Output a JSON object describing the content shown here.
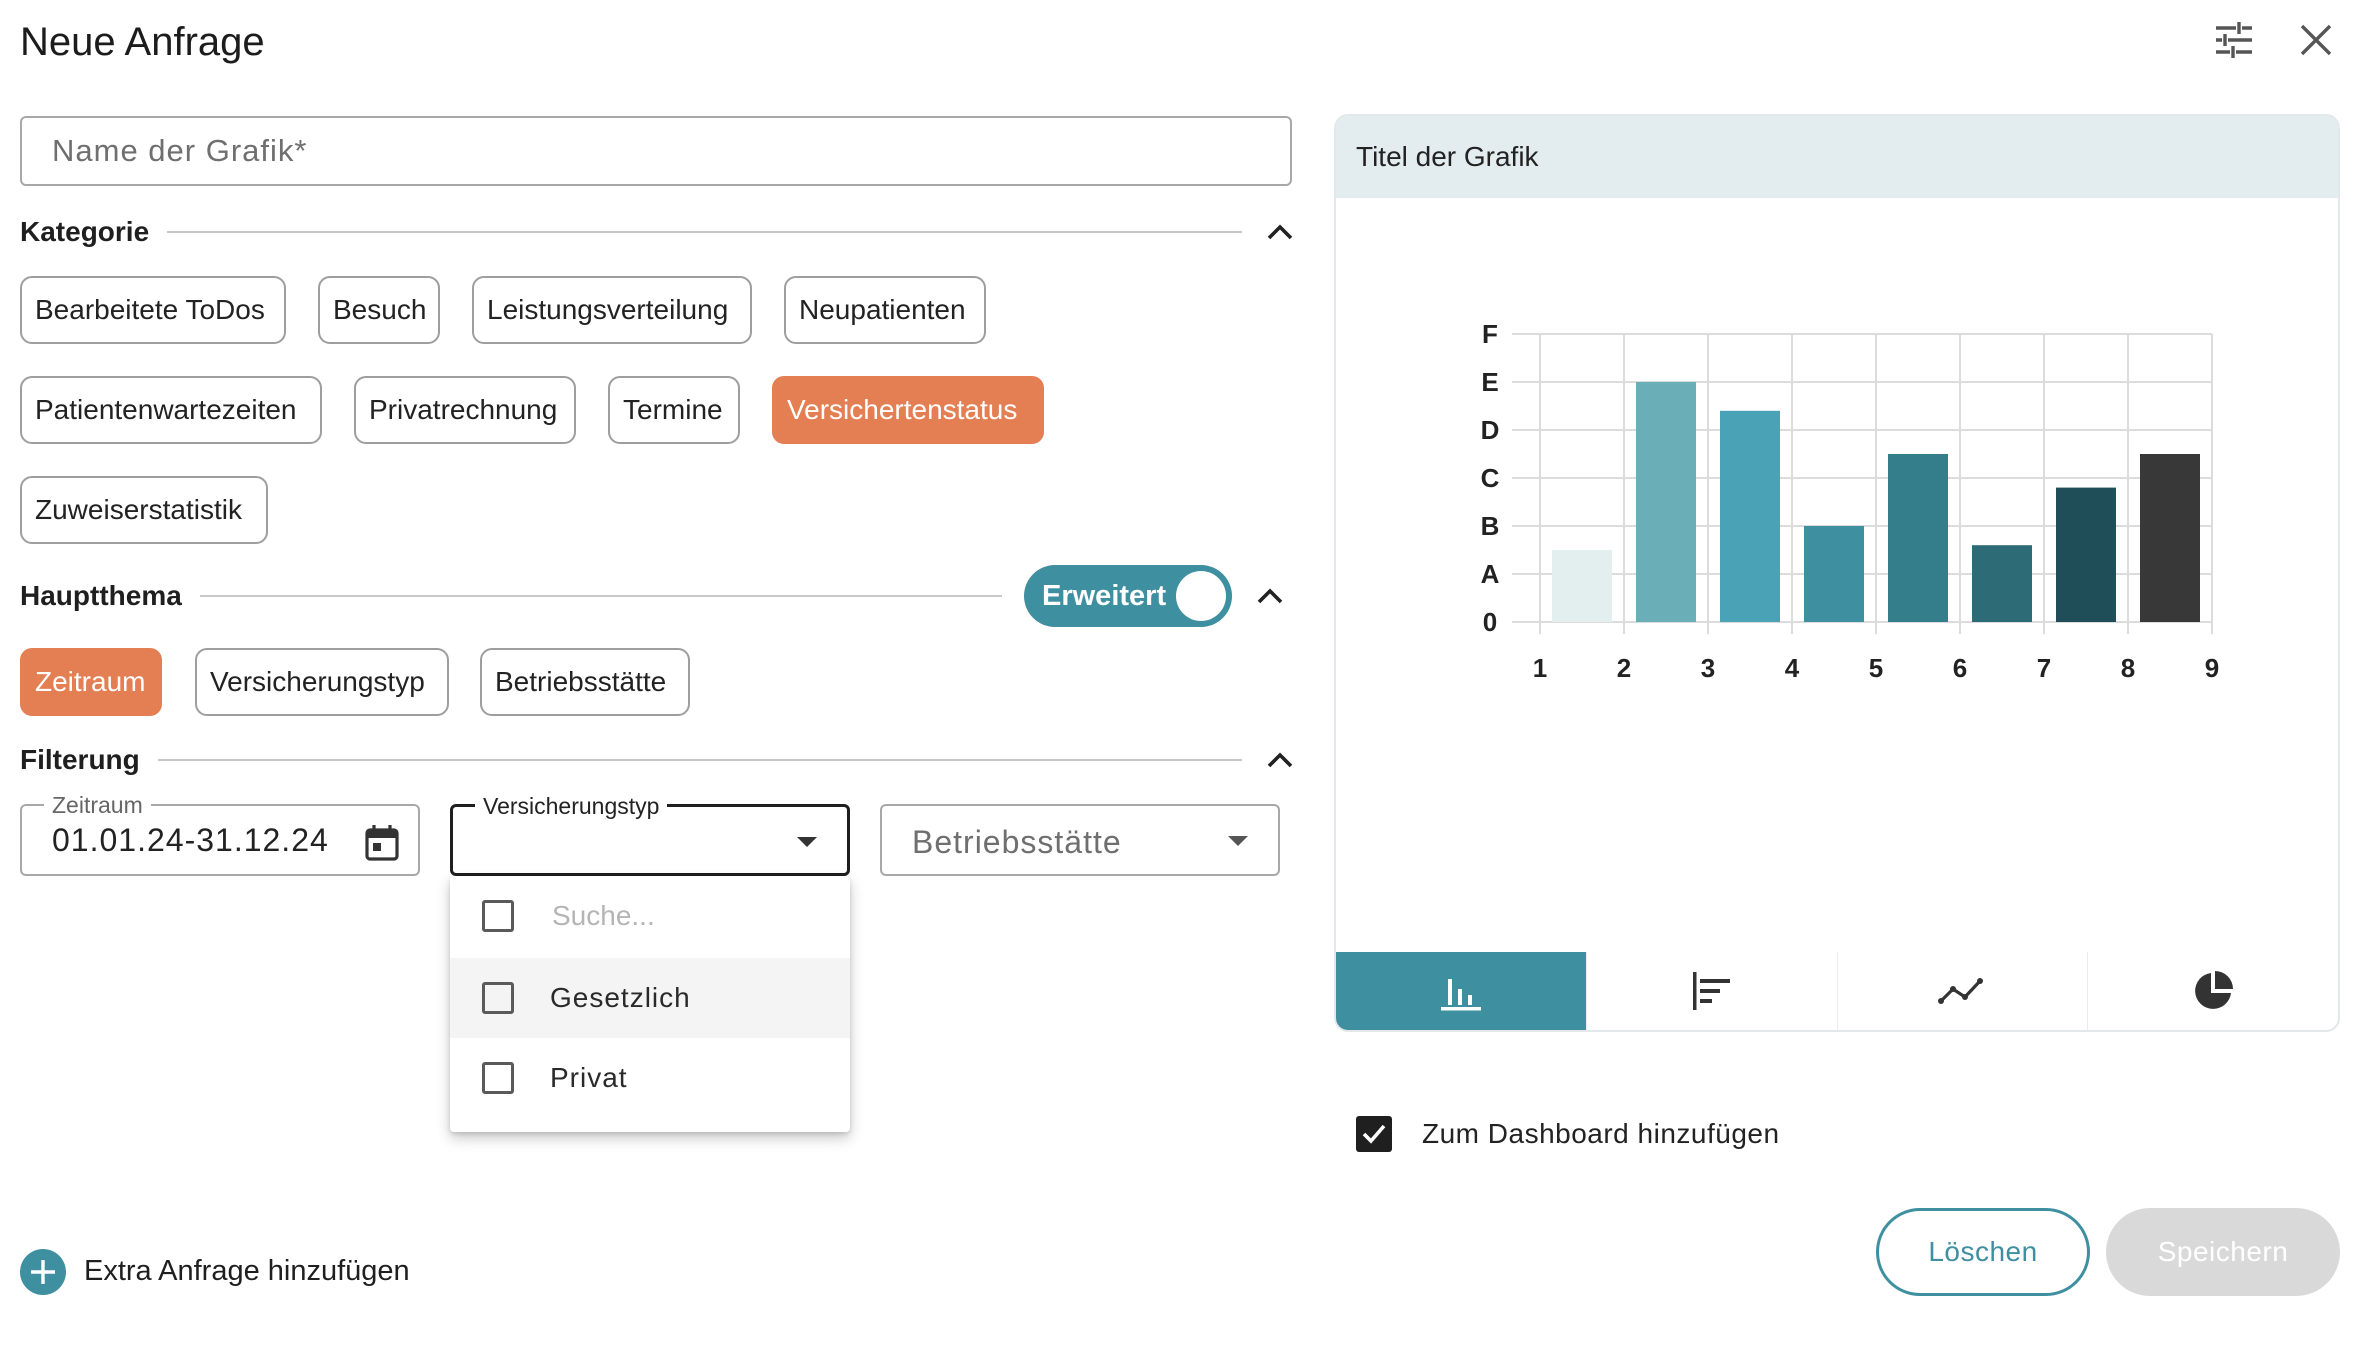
{
  "dialog": {
    "title": "Neue Anfrage"
  },
  "name_field": {
    "placeholder": "Name der Grafik*"
  },
  "sections": {
    "kategorie": {
      "label": "Kategorie"
    },
    "hauptthema": {
      "label": "Hauptthema",
      "toggle_label": "Erweitert",
      "toggle_on": true
    },
    "filterung": {
      "label": "Filterung"
    }
  },
  "kategorie_chips": [
    {
      "label": "Bearbeitete ToDos",
      "selected": false
    },
    {
      "label": "Besuch",
      "selected": false
    },
    {
      "label": "Leistungsverteilung",
      "selected": false
    },
    {
      "label": "Neupatienten",
      "selected": false
    },
    {
      "label": "Patientenwartezeiten",
      "selected": false
    },
    {
      "label": "Privatrechnung",
      "selected": false
    },
    {
      "label": "Termine",
      "selected": false
    },
    {
      "label": "Versichertenstatus",
      "selected": true
    },
    {
      "label": "Zuweiserstatistik",
      "selected": false
    }
  ],
  "hauptthema_chips": [
    {
      "label": "Zeitraum",
      "selected": true
    },
    {
      "label": "Versicherungstyp",
      "selected": false
    },
    {
      "label": "Betriebsstätte",
      "selected": false
    }
  ],
  "filters": {
    "zeitraum": {
      "label": "Zeitraum",
      "value": "01.01.24-31.12.24"
    },
    "versicherungstyp": {
      "label": "Versicherungstyp",
      "value": ""
    },
    "betriebsstaette": {
      "placeholder": "Betriebsstätte"
    }
  },
  "dropdown_menu": {
    "search_placeholder": "Suche...",
    "options": [
      "Gesetzlich",
      "Privat"
    ]
  },
  "preview": {
    "title": "Titel der Grafik",
    "tabs": [
      "bar-chart-icon",
      "horizontal-bar-icon",
      "line-chart-icon",
      "pie-chart-icon"
    ],
    "active_tab": 0
  },
  "chart_data": {
    "type": "bar",
    "x": [
      1,
      2,
      3,
      4,
      5,
      6,
      7,
      8,
      9
    ],
    "y_tick_labels": [
      "0",
      "A",
      "B",
      "C",
      "D",
      "E",
      "F"
    ],
    "values": [
      1.5,
      5.0,
      4.4,
      2.0,
      3.5,
      1.6,
      2.8,
      3.5
    ],
    "ylim": [
      0,
      6
    ],
    "bar_colors": [
      "#e3eeef",
      "#6aafb8",
      "#4aa2b6",
      "#3e8fa0",
      "#347d8b",
      "#2d6b77",
      "#1f4d58",
      "#383838"
    ],
    "grid": true
  },
  "dashboard": {
    "label": "Zum Dashboard hinzufügen",
    "checked": true
  },
  "buttons": {
    "delete": "Löschen",
    "save": "Speichern"
  },
  "extra": {
    "label": "Extra Anfrage hinzufügen"
  },
  "colors": {
    "accent": "#3e8fa0",
    "selected_chip": "#e47f54",
    "disabled": "#d9d9d9"
  }
}
